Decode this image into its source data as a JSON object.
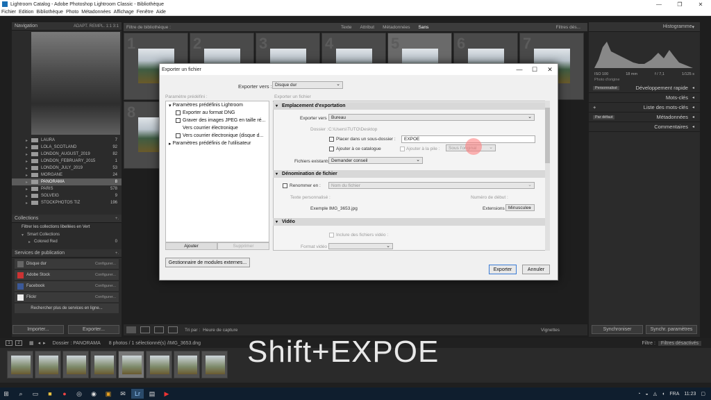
{
  "window": {
    "title": "Lightroom Catalog - Adobe Photoshop Lightroom Classic - Bibliothèque",
    "controls": [
      "—",
      "❐",
      "✕"
    ]
  },
  "menu": [
    "Fichier",
    "Edition",
    "Bibliothèque",
    "Photo",
    "Métadonnées",
    "Affichage",
    "Fenêtre",
    "Aide"
  ],
  "navigator": {
    "title": "Navigation",
    "options": "ADAPT.  REMPL.  1:1  3:1"
  },
  "folders": [
    {
      "name": "LAURA",
      "count": "7"
    },
    {
      "name": "LOLA_SCOTLAND",
      "count": "92"
    },
    {
      "name": "LONDON_AUGUST_2019",
      "count": "82"
    },
    {
      "name": "LONDON_FEBRUARY_2015",
      "count": "1"
    },
    {
      "name": "LONDON_JULY_2019",
      "count": "53"
    },
    {
      "name": "MORGANE",
      "count": "24"
    },
    {
      "name": "PANORAMA",
      "count": "8"
    },
    {
      "name": "PARIS",
      "count": "578"
    },
    {
      "name": "SOLVEIG",
      "count": "9"
    },
    {
      "name": "STOCKPHOTOS TIZ",
      "count": "196"
    }
  ],
  "collections": {
    "title": "Collections",
    "filter": "Filtrer les collections libellées en Vert",
    "smart": "Smart Collections",
    "colored": "Colored Red",
    "colored_count": "0"
  },
  "publish": {
    "title": "Services de publication",
    "services": [
      {
        "name": "Disque dur",
        "cfg": "Configurer..."
      },
      {
        "name": "Adobe Stock",
        "cfg": "Configurer..."
      },
      {
        "name": "Facebook",
        "cfg": "Configurer..."
      },
      {
        "name": "Flickr",
        "cfg": "Configurer..."
      }
    ],
    "more": "Rechercher plus de services en ligne..."
  },
  "left_buttons": {
    "import": "Importer...",
    "export": "Exporter..."
  },
  "library_filter": {
    "label": "Filtre de bibliothèque :",
    "tabs": [
      "Texte",
      "Attribut",
      "Métadonnées",
      "Sans"
    ],
    "right": "Filtres dés..."
  },
  "grid_numbers": [
    "1",
    "2",
    "3",
    "4",
    "5",
    "6",
    "7",
    "8"
  ],
  "right_panel": {
    "histogram": "Histogramme",
    "meta": [
      "ISO 100",
      "18 mm",
      "f / 7,1",
      "1/125 s"
    ],
    "original": "Photo d'origine",
    "quick_dev": "Développement rapide",
    "quick_preset": "Personnalisé",
    "keywords": "Mots-clés",
    "keyword_list": "Liste des mots-clés",
    "metadata": "Métadonnées",
    "metadata_preset": "Par défaut",
    "comments": "Commentaires",
    "sync": "Synchroniser",
    "sync_settings": "Synchr. paramètres"
  },
  "toolbar": {
    "sort": "Tri par :",
    "sort_value": "Heure de capture",
    "thumbs": "Vignettes"
  },
  "filmhead": {
    "folder": "Dossier : PANORAMA",
    "status": "8 photos / 1 sélectionné(s) /IMG_3653.dng",
    "filter": "Filtre :",
    "filter_value": "Filtres désactivés"
  },
  "overlay": "Shift+EXPOE",
  "taskbar": {
    "lang": "FRA",
    "time": "11:23"
  },
  "dialog": {
    "title": "Exporter un fichier",
    "export_to_label": "Exporter vers :",
    "export_to_value": "Disque dur",
    "presets_label": "Paramètre prédéfini :",
    "export_file_label": "Exporter un fichier",
    "presets": {
      "group1": "Paramètres prédéfinis Lightroom",
      "items": [
        "Exporter au format DNG",
        "Graver des images JPEG en taille ré...",
        "Vers courrier électronique",
        "Vers courrier électronique (disque d..."
      ],
      "group2": "Paramètres prédéfinis de l'utilisateur"
    },
    "add": "Ajouter",
    "remove": "Supprimer",
    "location": {
      "head": "Emplacement d'exportation",
      "export_to": "Exporter vers :",
      "export_to_val": "Bureau",
      "folder": "Dossier :",
      "folder_val": "C:\\Users\\TUTO\\Desktop",
      "subfolder": "Placer dans un sous-dossier :",
      "subfolder_val": "EXPOE",
      "add_catalog": "Ajouter à ce catalogue",
      "add_stack": "Ajouter à la pile :",
      "stack_val": "Sous l'original",
      "existing": "Fichiers existants :",
      "existing_val": "Demander conseil"
    },
    "naming": {
      "head": "Dénomination de fichier",
      "rename": "Renommer en :",
      "rename_val": "Nom du fichier",
      "custom": "Texte personnalisé :",
      "start": "Numéro de début :",
      "example": "Exemple :",
      "example_val": "IMG_3653.jpg",
      "ext": "Extensions :",
      "ext_val": "Minuscules"
    },
    "video": {
      "head": "Vidéo",
      "include": "Inclure des fichiers vidéo :",
      "format": "Format vidéo :"
    },
    "modules": "Gestionnaire de modules externes...",
    "export": "Exporter",
    "cancel": "Annuler"
  }
}
